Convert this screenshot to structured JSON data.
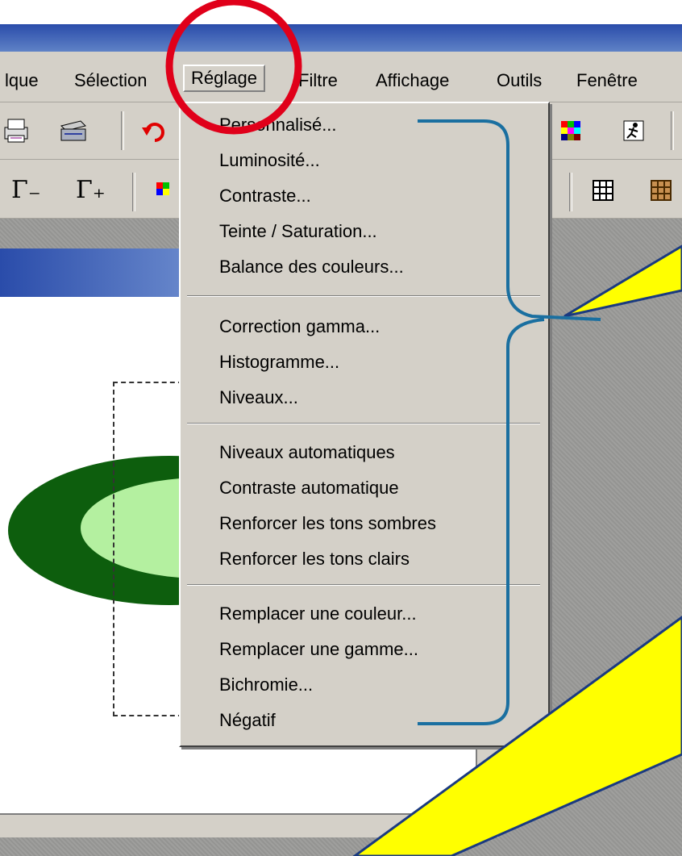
{
  "menubar": {
    "items": [
      "lque",
      "Sélection",
      "Réglage",
      "Filtre",
      "Affichage",
      "Outils",
      "Fenêtre"
    ]
  },
  "toolbar2": {
    "gamma_minus": "Γ₋",
    "gamma_plus": "Γ₊"
  },
  "dropdown": {
    "groups": [
      [
        "Personnalisé...",
        "Luminosité...",
        "Contraste...",
        "Teinte / Saturation...",
        "Balance des couleurs..."
      ],
      [
        "Correction gamma...",
        "Histogramme...",
        "Niveaux..."
      ],
      [
        "Niveaux automatiques",
        "Contraste automatique",
        "Renforcer les tons sombres",
        "Renforcer les tons clairs"
      ],
      [
        "Remplacer une couleur...",
        "Remplacer une gamme...",
        "Bichromie...",
        "Négatif"
      ]
    ]
  },
  "colors": {
    "highlight_circle": "#e0001a",
    "bracket": "#1a6fa0",
    "callout_fill": "#ffff00",
    "menu_bg": "#d4d0c8",
    "ellipse_dark": "#0d5e0d",
    "ellipse_light": "#b4f0a0"
  },
  "icons": [
    "print-icon",
    "scanner-icon",
    "undo-icon",
    "color-grid-icon",
    "run-icon",
    "grid-icon",
    "brown-grid-icon",
    "rgb-square-icon"
  ]
}
